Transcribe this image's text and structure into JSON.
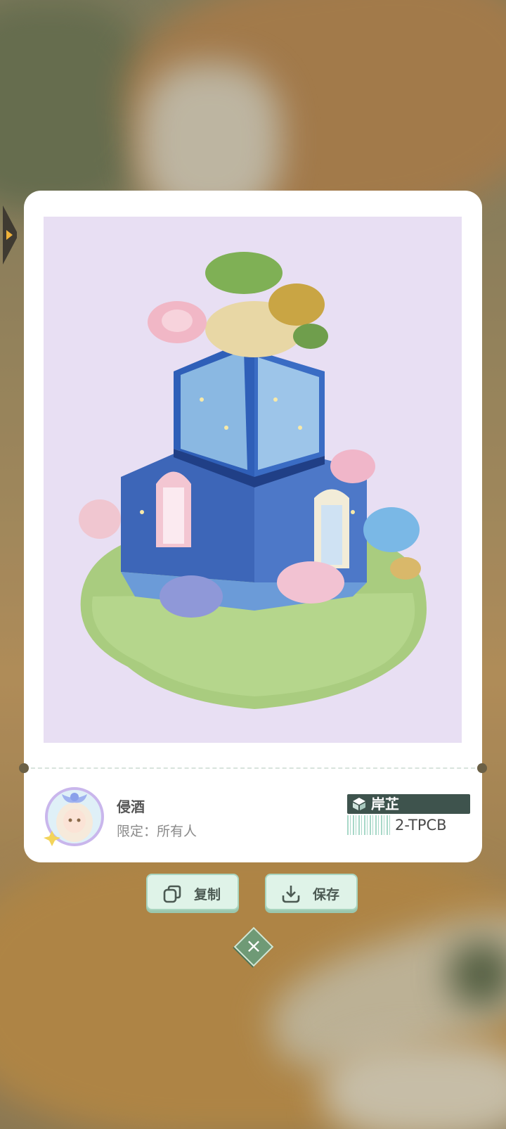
{
  "author": {
    "name": "侵酒",
    "visibility": "限定：所有人"
  },
  "share": {
    "tag_label": "岸芷",
    "code": "2-TPCB"
  },
  "actions": {
    "copy_label": "复制",
    "save_label": "保存"
  },
  "colors": {
    "accent": "#dff3e8",
    "tag_bg": "#3e534d",
    "image_bg": "#e8dff3"
  },
  "icons": [
    "copy-icon",
    "download-icon",
    "close-icon",
    "cube-icon",
    "expand-arrow-icon"
  ]
}
